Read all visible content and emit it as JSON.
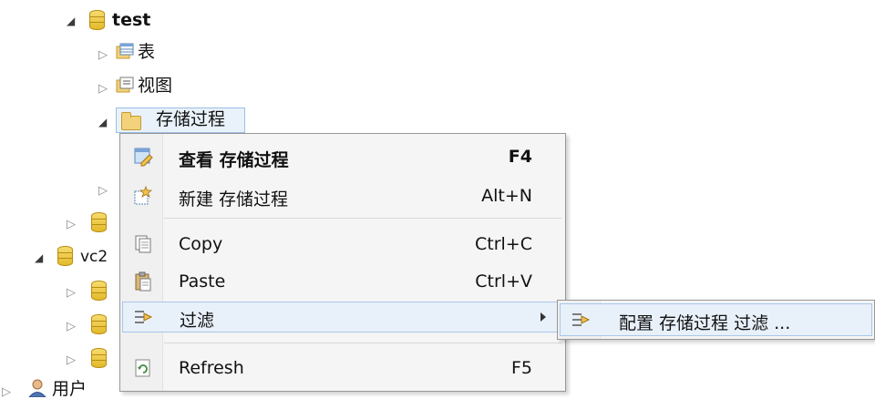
{
  "tree": {
    "db_test": "test",
    "tables": "表",
    "views": "视图",
    "procs": "存储过程",
    "db_vc2": "vc2",
    "users": "用户"
  },
  "context_menu": {
    "items": [
      {
        "label": "查看 存储过程",
        "shortcut": "F4",
        "icon": "edit-icon"
      },
      {
        "label": "新建 存储过程",
        "shortcut": "Alt+N",
        "icon": "new-icon"
      },
      {
        "label": "Copy",
        "shortcut": "Ctrl+C",
        "icon": "copy-icon"
      },
      {
        "label": "Paste",
        "shortcut": "Ctrl+V",
        "icon": "paste-icon"
      },
      {
        "label": "过滤",
        "shortcut": "",
        "icon": "filter-icon"
      },
      {
        "label": "Refresh",
        "shortcut": "F5",
        "icon": "refresh-icon"
      }
    ]
  },
  "submenu": {
    "label": "配置 存储过程 过滤 ..."
  }
}
